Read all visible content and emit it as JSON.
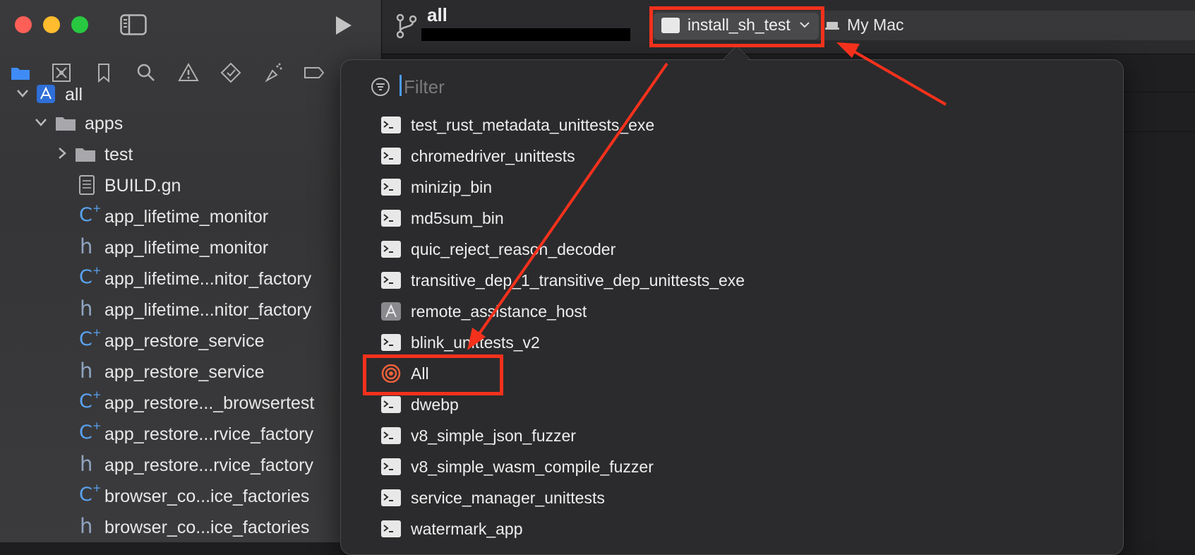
{
  "toolbar": {
    "project_name": "all",
    "scheme_name": "install_sh_test",
    "destination": "My Mac"
  },
  "filter": {
    "placeholder": "Filter"
  },
  "navigator": {
    "tabs": [
      "folder-icon",
      "source-control-icon",
      "bookmark-icon",
      "search-icon",
      "warning-icon",
      "test-icon",
      "debug-icon",
      "tag-icon"
    ],
    "items": [
      {
        "label": "all",
        "kind": "project",
        "level": 0,
        "expanded": true
      },
      {
        "label": "apps",
        "kind": "folder",
        "level": 1,
        "expanded": true
      },
      {
        "label": "test",
        "kind": "folder",
        "level": 2,
        "expanded": false
      },
      {
        "label": "BUILD.gn",
        "kind": "file",
        "level": 2
      },
      {
        "label": "app_lifetime_monitor",
        "kind": "cpp",
        "level": 2
      },
      {
        "label": "app_lifetime_monitor",
        "kind": "h",
        "level": 2
      },
      {
        "label": "app_lifetime...nitor_factory",
        "kind": "cpp",
        "level": 2
      },
      {
        "label": "app_lifetime...nitor_factory",
        "kind": "h",
        "level": 2
      },
      {
        "label": "app_restore_service",
        "kind": "cpp",
        "level": 2
      },
      {
        "label": "app_restore_service",
        "kind": "h",
        "level": 2
      },
      {
        "label": "app_restore..._browsertest",
        "kind": "cpp",
        "level": 2
      },
      {
        "label": "app_restore...rvice_factory",
        "kind": "cpp",
        "level": 2
      },
      {
        "label": "app_restore...rvice_factory",
        "kind": "h",
        "level": 2
      },
      {
        "label": "browser_co...ice_factories",
        "kind": "cpp",
        "level": 2
      },
      {
        "label": "browser_co...ice_factories",
        "kind": "h",
        "level": 2
      }
    ]
  },
  "targets": [
    {
      "label": "test_rust_metadata_unittests_exe",
      "icon": "terminal"
    },
    {
      "label": "chromedriver_unittests",
      "icon": "terminal"
    },
    {
      "label": "minizip_bin",
      "icon": "terminal"
    },
    {
      "label": "md5sum_bin",
      "icon": "terminal"
    },
    {
      "label": "quic_reject_reason_decoder",
      "icon": "terminal"
    },
    {
      "label": "transitive_dep_1_transitive_dep_unittests_exe",
      "icon": "terminal"
    },
    {
      "label": "remote_assistance_host",
      "icon": "app"
    },
    {
      "label": "blink_unittests_v2",
      "icon": "terminal"
    },
    {
      "label": "All",
      "icon": "target"
    },
    {
      "label": "dwebp",
      "icon": "terminal"
    },
    {
      "label": "v8_simple_json_fuzzer",
      "icon": "terminal"
    },
    {
      "label": "v8_simple_wasm_compile_fuzzer",
      "icon": "terminal"
    },
    {
      "label": "service_manager_unittests",
      "icon": "terminal"
    },
    {
      "label": "watermark_app",
      "icon": "terminal"
    }
  ],
  "colors": {
    "annotation": "#f5311c",
    "accent": "#4d9cf8"
  }
}
